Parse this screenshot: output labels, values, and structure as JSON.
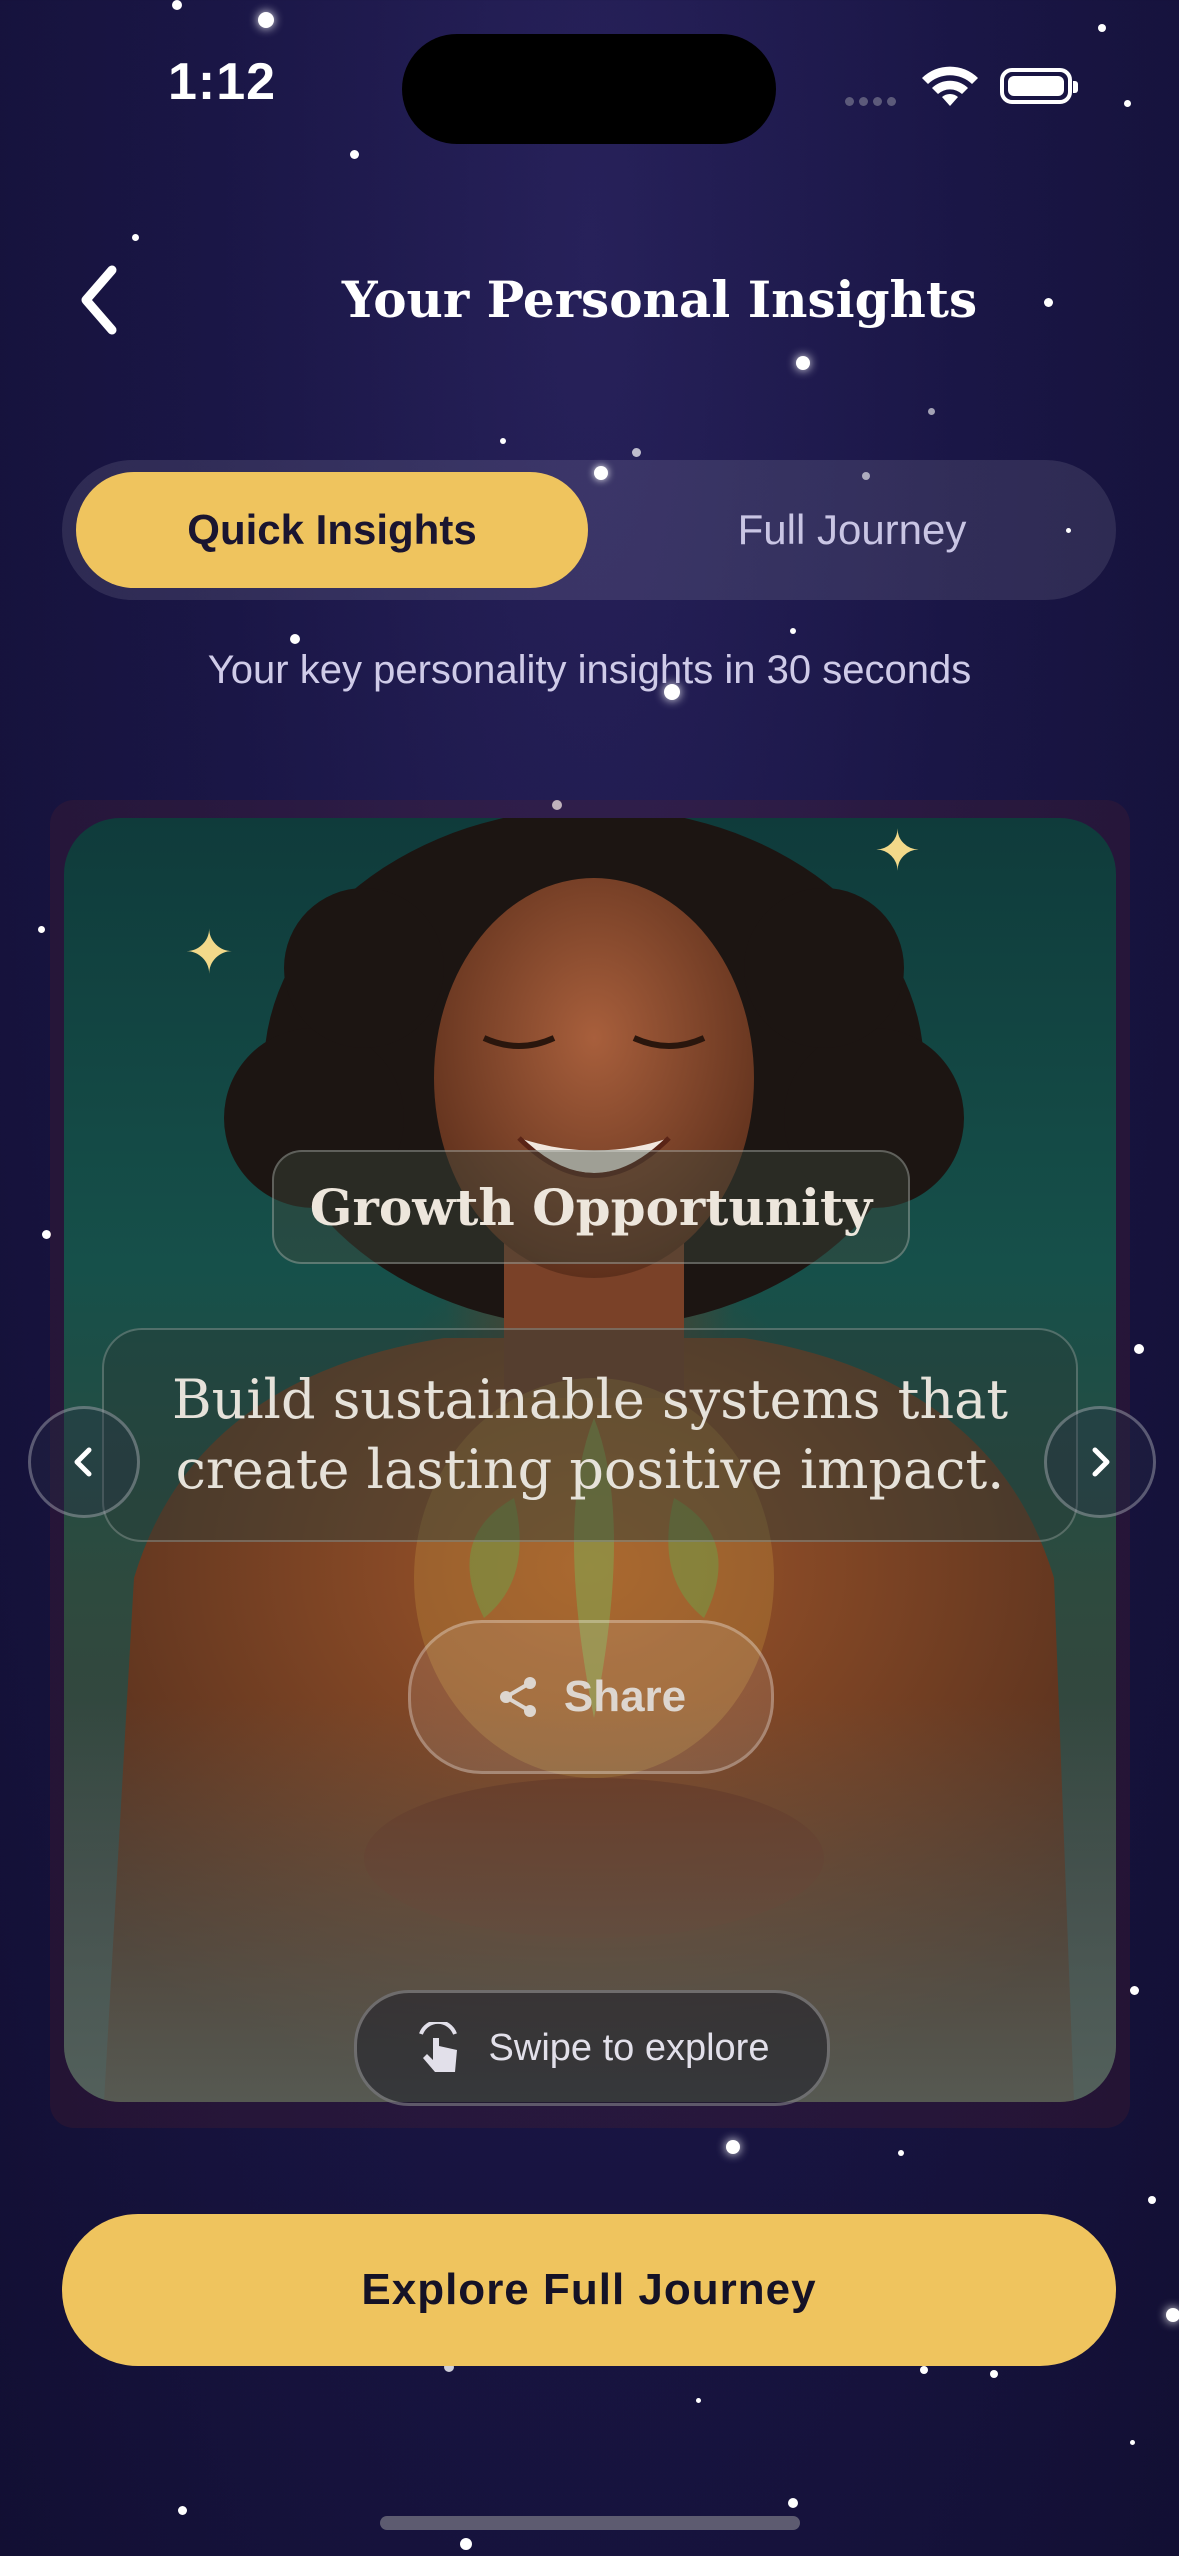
{
  "status_bar": {
    "time": "1:12"
  },
  "header": {
    "title": "Your Personal Insights"
  },
  "segmented": {
    "active_label": "Quick Insights",
    "inactive_label": "Full Journey"
  },
  "subtitle": "Your key personality insights in 30 seconds",
  "card": {
    "heading": "Growth Opportunity",
    "insight": "Build sustainable systems that create lasting positive impact.",
    "share_label": "Share",
    "swipe_hint": "Swipe to explore"
  },
  "cta": {
    "label": "Explore Full Journey"
  },
  "colors": {
    "accent": "#efc45e",
    "background": "#1a1646"
  },
  "icons": [
    "back-chevron-icon",
    "wifi-icon",
    "battery-icon",
    "chevron-left-icon",
    "chevron-right-icon",
    "share-icon",
    "swipe-hand-icon"
  ]
}
